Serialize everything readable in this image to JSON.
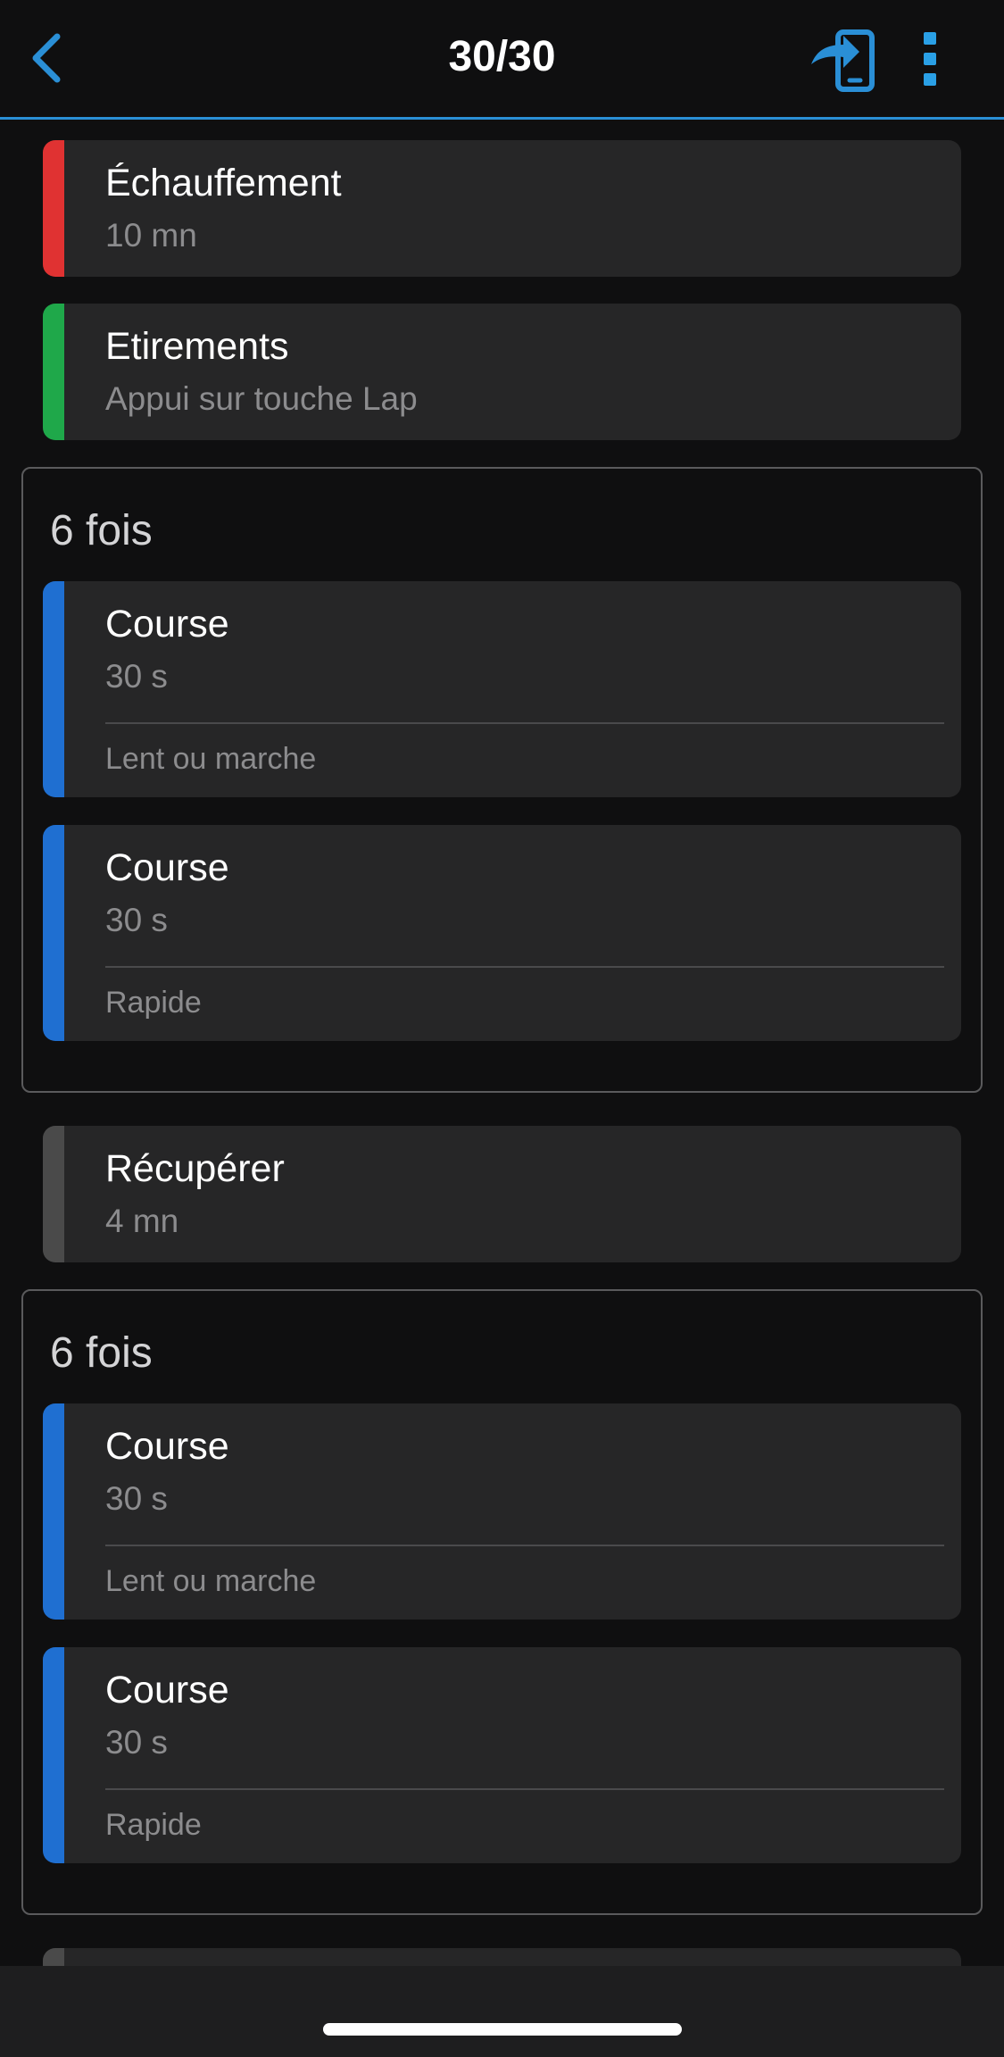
{
  "header": {
    "title": "30/30",
    "back_icon": "chevron-left-icon",
    "send_icon": "send-to-device-icon",
    "more_icon": "more-vertical-icon",
    "accent_color": "#2a8fd6"
  },
  "steps": {
    "warmup": {
      "name": "Échauffement",
      "duration": "10 mn",
      "color": "#e03232"
    },
    "stretch": {
      "name": "Etirements",
      "duration": "Appui sur touche Lap",
      "color": "#1fa84a"
    },
    "recover": {
      "name": "Récupérer",
      "duration": "4 mn",
      "color": "#4a4a4a"
    }
  },
  "repeats": [
    {
      "label": "6 fois",
      "steps": [
        {
          "name": "Course",
          "duration": "30 s",
          "note": "Lent ou marche",
          "color": "#1f6fd1"
        },
        {
          "name": "Course",
          "duration": "30 s",
          "note": "Rapide",
          "color": "#1f6fd1"
        }
      ]
    },
    {
      "label": "6 fois",
      "steps": [
        {
          "name": "Course",
          "duration": "30 s",
          "note": "Lent ou marche",
          "color": "#1f6fd1"
        },
        {
          "name": "Course",
          "duration": "30 s",
          "note": "Rapide",
          "color": "#1f6fd1"
        }
      ]
    }
  ],
  "partial_step_color": "#4a4a4a"
}
